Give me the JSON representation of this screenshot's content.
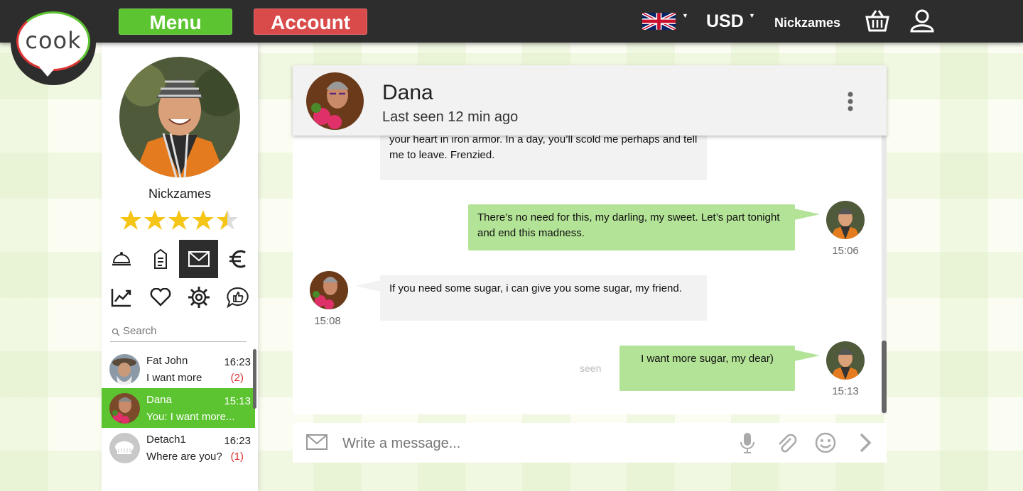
{
  "header": {
    "logo_text": "cook",
    "menu_label": "Menu",
    "account_label": "Account",
    "language_icon": "uk-flag-icon",
    "currency": "USD",
    "username": "Nickzames",
    "colors": {
      "bar": "#2d2d2d",
      "menu": "#5cc430",
      "account": "#d94a4a"
    }
  },
  "sidebar": {
    "profile_name": "Nickzames",
    "rating": 4.5,
    "rating_max": 5,
    "nav_icons": [
      "cloche-icon",
      "order-tag-icon",
      "mail-icon",
      "euro-icon",
      "chart-icon",
      "heart-icon",
      "gear-icon",
      "thumbs-up-chat-icon"
    ],
    "active_icon": "mail-icon",
    "search_placeholder": "Search",
    "contacts": [
      {
        "name": "Fat John",
        "preview": "I want more",
        "time": "16:23",
        "unread": "(2)"
      },
      {
        "name": "Dana",
        "preview": "You: I want more...",
        "time": "15:13",
        "unread": ""
      },
      {
        "name": "Detach1",
        "preview": "Where are you?",
        "time": "16:23",
        "unread": "(1)"
      }
    ]
  },
  "chat": {
    "contact_name": "Dana",
    "status": "Last seen 12 min ago",
    "messages": [
      {
        "direction": "in",
        "text": "your heart in iron armor. In a day,  you’ll scold me perhaps and tell me to leave. Frenzied.",
        "time": ""
      },
      {
        "direction": "out",
        "text": "There’s no need for this, my darling, my sweet. Let’s part tonight and end this madness.",
        "time": "15:06"
      },
      {
        "direction": "in",
        "text": "If you need some sugar, i can give you some sugar, my friend.",
        "time": "15:08"
      },
      {
        "direction": "out",
        "text": "I want more sugar, my dear)",
        "time": "15:13"
      }
    ],
    "seen_label": "seen",
    "compose_placeholder": "Write a message...",
    "compose_icons": [
      "mail-icon",
      "microphone-icon",
      "paperclip-icon",
      "smiley-icon",
      "send-icon"
    ]
  }
}
